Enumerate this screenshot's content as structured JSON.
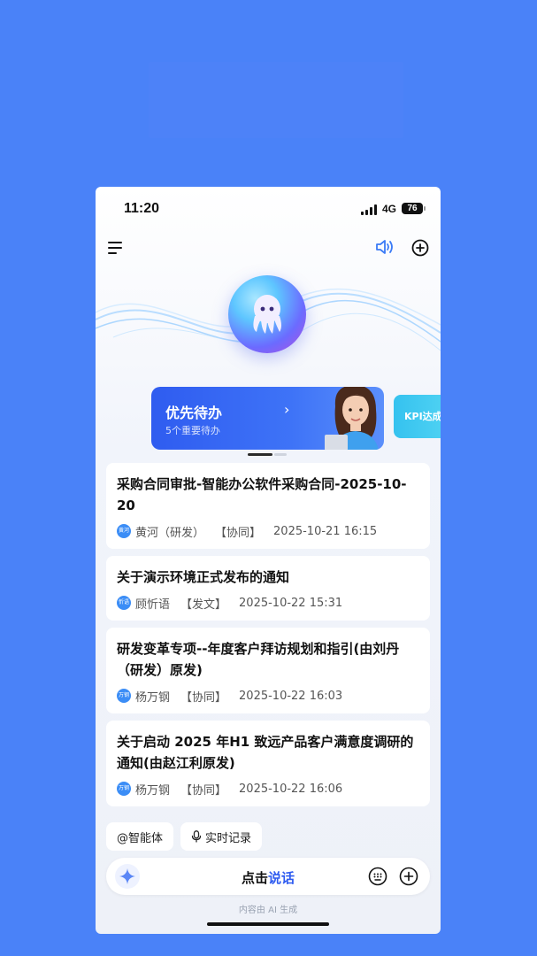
{
  "status_bar": {
    "time": "11:20",
    "network": "4G",
    "battery": "76"
  },
  "priority_card": {
    "title": "优先待办",
    "subtitle": "5个重要待办"
  },
  "kpi_card": {
    "title": "KPI达成"
  },
  "items": [
    {
      "title": "采购合同审批-智能办公软件采购合同-2025-10-20",
      "avatar": "黄河",
      "name": "黄河（研发）",
      "tag": "【协同】",
      "time": "2025-10-21 16:15"
    },
    {
      "title": "关于演示环境正式发布的通知",
      "avatar": "忻语",
      "name": "顾忻语",
      "tag": "【发文】",
      "time": "2025-10-22 15:31"
    },
    {
      "title": "研发变革专项--年度客户拜访规划和指引(由刘丹（研发）原发)",
      "avatar": "万钢",
      "name": "杨万钢",
      "tag": "【协同】",
      "time": "2025-10-22 16:03"
    },
    {
      "title": "关于启动 2025 年H1 致远产品客户满意度调研的通知(由赵江利原发)",
      "avatar": "万钢",
      "name": "杨万钢",
      "tag": "【协同】",
      "time": "2025-10-22 16:06"
    }
  ],
  "chips": {
    "agent": "@智能体",
    "record": "实时记录"
  },
  "input": {
    "prefix": "点击",
    "highlight": "说话"
  },
  "footer": "内容由 AI 生成",
  "colors": {
    "accent": "#2f5cf0",
    "background": "#4a82f8"
  }
}
